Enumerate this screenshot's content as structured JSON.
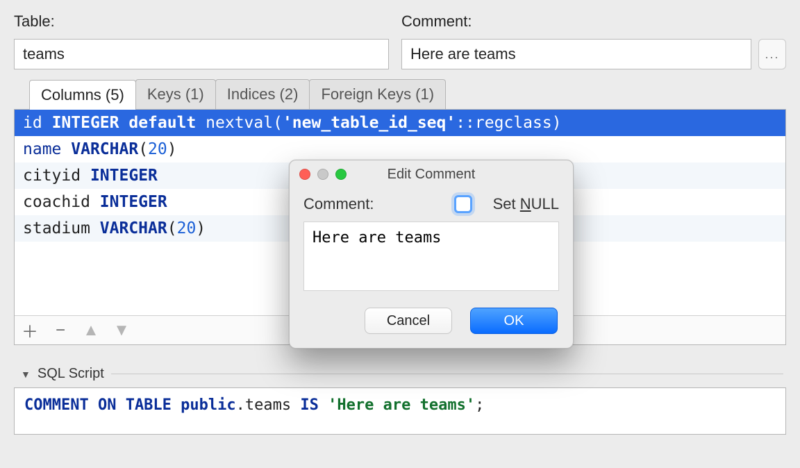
{
  "labels": {
    "table": "Table:",
    "comment": "Comment:",
    "sql_section": "SQL Script"
  },
  "inputs": {
    "table_name": "teams",
    "comment": "Here are teams",
    "ellipsis": "..."
  },
  "tabs": [
    {
      "label": "Columns (5)",
      "active": true
    },
    {
      "label": "Keys (1)",
      "active": false
    },
    {
      "label": "Indices (2)",
      "active": false
    },
    {
      "label": "Foreign Keys (1)",
      "active": false
    }
  ],
  "columns": [
    {
      "name": "id",
      "type": "INTEGER",
      "extra_kw": "default",
      "extra_fn": "nextval",
      "extra_str": "'new_table_id_seq'",
      "extra_cast": "::regclass",
      "selected": true
    },
    {
      "name": "name",
      "type": "VARCHAR",
      "size": "20"
    },
    {
      "name": "cityid",
      "type": "INTEGER"
    },
    {
      "name": "coachid",
      "type": "INTEGER"
    },
    {
      "name": "stadium",
      "type": "VARCHAR",
      "size": "20"
    }
  ],
  "sql": {
    "kw1": "COMMENT ON TABLE",
    "schema": "public",
    "dot": ".",
    "obj": "teams",
    "kw2": "IS",
    "str": "'Here are teams'",
    "semi": ";"
  },
  "dialog": {
    "title": "Edit Comment",
    "label": "Comment:",
    "set_null_prefix": "Set ",
    "set_null_ul": "N",
    "set_null_suffix": "ULL",
    "text": "Here are teams",
    "cancel": "Cancel",
    "ok": "OK"
  }
}
